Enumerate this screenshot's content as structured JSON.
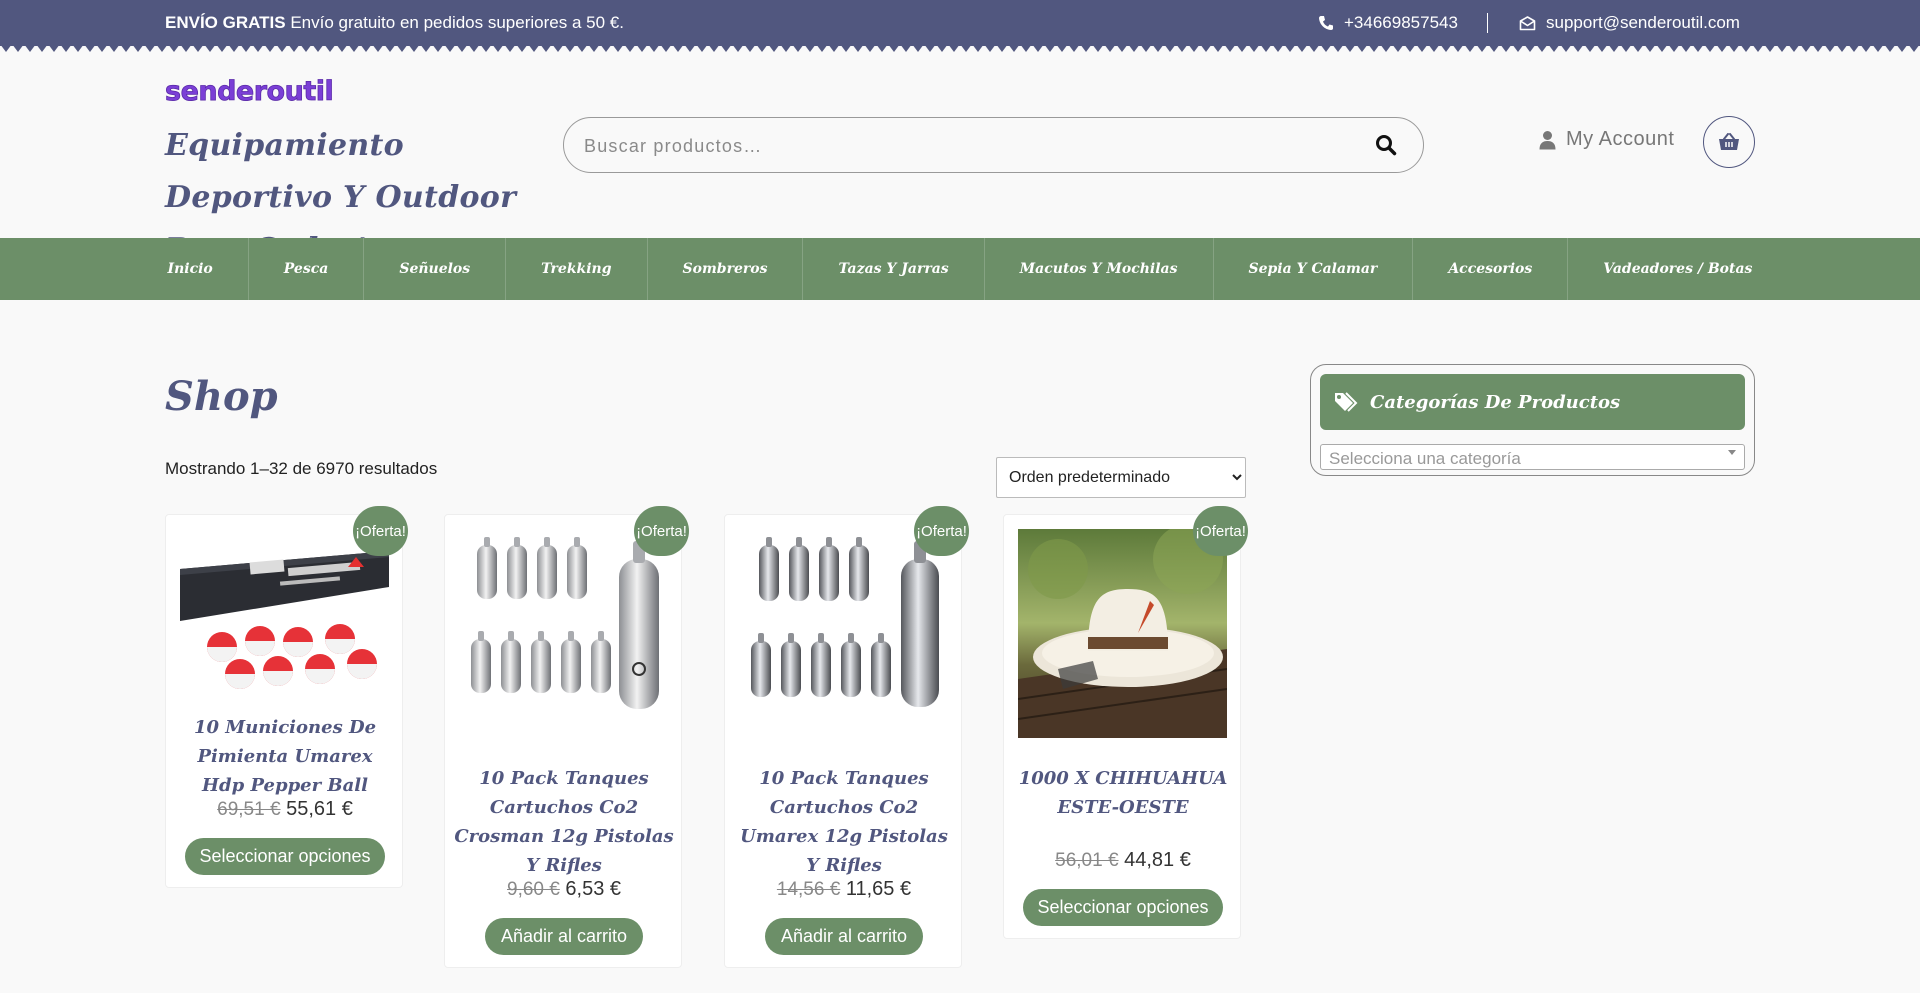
{
  "topbar": {
    "promo_strong": "ENVÍO GRATIS",
    "promo_text": "Envío gratuito en pedidos superiores a 50 €.",
    "phone": "+34669857543",
    "email": "support@senderoutil.com"
  },
  "header": {
    "logo_text": "senderoutil",
    "tagline": "Equipamiento Deportivo Y Outdoor Para Cada Aventura",
    "search_placeholder": "Buscar productos…",
    "account_label": "My Account"
  },
  "nav": {
    "items": [
      {
        "label": "Inicio"
      },
      {
        "label": "Pesca"
      },
      {
        "label": "Señuelos"
      },
      {
        "label": "Trekking"
      },
      {
        "label": "Sombreros"
      },
      {
        "label": "Tazas Y Jarras"
      },
      {
        "label": "Macutos Y Mochilas"
      },
      {
        "label": "Sepia Y Calamar"
      },
      {
        "label": "Accesorios"
      },
      {
        "label": "Vadeadores / Botas"
      }
    ]
  },
  "main": {
    "title": "Shop",
    "result_count": "Mostrando 1–32 de 6970 resultados",
    "orderby": "Orden predeterminado",
    "badge": "¡Oferta!",
    "products": [
      {
        "title": "10 Municiones De Pimienta Umarex Hdp Pepper Ball",
        "old_price": "69,51 €",
        "price": "55,61 €",
        "button": "Seleccionar opciones",
        "image": "pepper-balls"
      },
      {
        "title": "10 Pack Tanques Cartuchos Co2 Crosman 12g Pistolas Y Rifles",
        "old_price": "9,60 €",
        "price": "6,53 €",
        "button": "Añadir al carrito",
        "image": "co2-cartridges"
      },
      {
        "title": "10 Pack Tanques Cartuchos Co2 Umarex 12g Pistolas Y Rifles",
        "old_price": "14,56 €",
        "price": "11,65 €",
        "button": "Añadir al carrito",
        "image": "co2-cartridges"
      },
      {
        "title": "1000 X CHIHUAHUA ESTE-OESTE",
        "old_price": "56,01 €",
        "price": "44,81 €",
        "button": "Seleccionar opciones",
        "image": "cowboy-hat"
      }
    ]
  },
  "sidebar": {
    "widget_title": "Categorías De Productos",
    "select_placeholder": "Selecciona una categoría"
  },
  "colors": {
    "topbar": "#51577f",
    "nav": "#6c8f68",
    "accent_text": "#51577f",
    "logo": "#7b3fd6"
  }
}
